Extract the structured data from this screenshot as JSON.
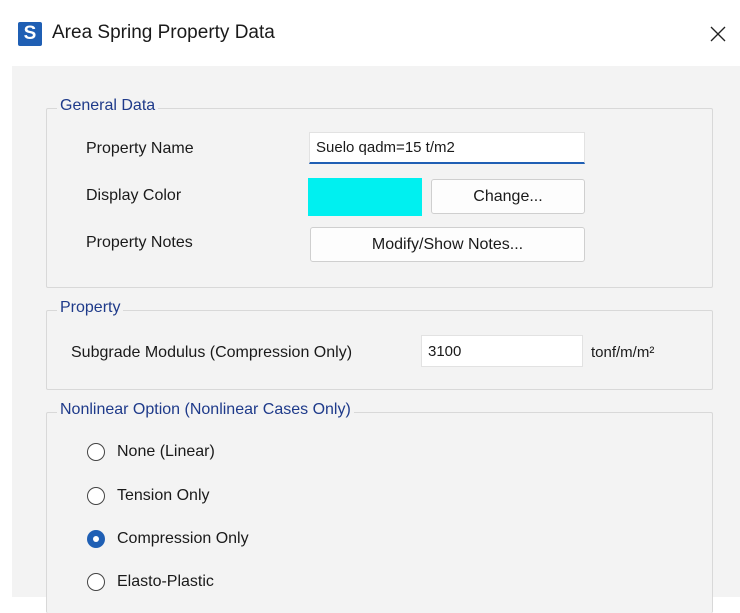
{
  "window": {
    "app_icon_letter": "S",
    "title": "Area Spring Property Data",
    "close_glyph": "close-icon"
  },
  "general_data": {
    "title": "General Data",
    "property_name_label": "Property Name",
    "property_name_value": "Suelo qadm=15 t/m2",
    "display_color_label": "Display Color",
    "display_color_value": "#00f0f0",
    "change_button": "Change...",
    "property_notes_label": "Property Notes",
    "notes_button": "Modify/Show Notes..."
  },
  "property": {
    "title": "Property",
    "subgrade_label": "Subgrade Modulus  (Compression Only)",
    "subgrade_value": "3100",
    "subgrade_unit": "tonf/m/m²"
  },
  "nonlinear": {
    "title": "Nonlinear Option  (Nonlinear Cases Only)",
    "options": [
      {
        "label": "None (Linear)",
        "checked": false
      },
      {
        "label": "Tension Only",
        "checked": false
      },
      {
        "label": "Compression Only",
        "checked": true
      },
      {
        "label": "Elasto-Plastic",
        "checked": false
      }
    ]
  },
  "colors": {
    "accent": "#1f5fb4",
    "group_title": "#1e3a8a"
  }
}
